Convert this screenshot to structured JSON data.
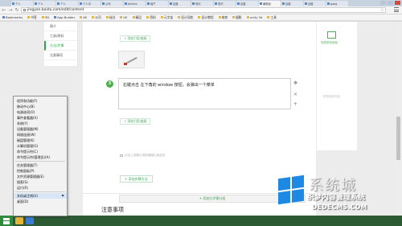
{
  "browser": {
    "tabs": [
      {
        "label": "个人"
      },
      {
        "label": "个人"
      },
      {
        "label": "个人"
      },
      {
        "label": "个人中"
      },
      {
        "label": "公司"
      },
      {
        "label": "Jenkins"
      },
      {
        "label": "用户"
      },
      {
        "label": "百度"
      },
      {
        "label": "常识"
      },
      {
        "label": "常识"
      },
      {
        "label": "百度"
      },
      {
        "label": "编辑经"
      },
      {
        "label": "百度"
      },
      {
        "label": "百度"
      },
      {
        "label": "goog"
      }
    ],
    "active_tab_index": 11,
    "url": "jingyan.baidu.com/edit/content",
    "bookmarks": [
      {
        "label": "Bookmarks"
      },
      {
        "label": "书签"
      },
      {
        "label": "3D"
      },
      {
        "label": "App Builder"
      },
      {
        "label": "AE"
      },
      {
        "label": "公司"
      },
      {
        "label": "硅谷"
      },
      {
        "label": "UE"
      },
      {
        "label": "精品"
      },
      {
        "label": "资料"
      },
      {
        "label": "元字宙"
      },
      {
        "label": "设计导航"
      },
      {
        "label": "设计教程"
      },
      {
        "label": "电商"
      },
      {
        "label": "摄影"
      },
      {
        "label": "unity 3d"
      },
      {
        "label": "工具"
      }
    ]
  },
  "leftnav": {
    "items": [
      {
        "label": "简介"
      },
      {
        "label": "工具/原料"
      },
      {
        "label": "方法/步骤"
      },
      {
        "label": "注意事项"
      }
    ]
  },
  "editor": {
    "add_link_label": "+ 添加引用/链接",
    "step_number": "3",
    "step_text": "右键点击 左下角的 window 按钮，会弹出一个菜单",
    "upload_hint": "点击上传图片或拖拽图片到此处",
    "add_step_label": "+ 添加步骤方法",
    "add_group_label": "+ 添加分步骤分组",
    "attention_title": "注意事项"
  },
  "right_panel": {
    "publish_label": "完成发布经验",
    "preview_label": "预览经验内容"
  },
  "context_menu": {
    "items": [
      {
        "label": "程序和功能(F)"
      },
      {
        "label": "移动中心(B)"
      },
      {
        "label": "电源选项(O)"
      },
      {
        "label": "事件查看器(V)"
      },
      {
        "label": "系统(Y)"
      },
      {
        "label": "设备管理器(M)"
      },
      {
        "label": "网络连接(W)"
      },
      {
        "label": "磁盘管理(K)"
      },
      {
        "label": "计算机管理(G)"
      },
      {
        "label": "命令提示符(C)"
      },
      {
        "label": "命令提示符(管理员)(A)"
      },
      {
        "label": "任务管理器(T)"
      },
      {
        "label": "控制面板(P)"
      },
      {
        "label": "文件资源管理器(E)"
      },
      {
        "label": "搜索(S)"
      },
      {
        "label": "运行(R)"
      },
      {
        "label": "关机或注销(U)"
      },
      {
        "label": "桌面(D)"
      }
    ],
    "submenu_arrow": "▶"
  },
  "watermark": {
    "big_text": "系统城",
    "sub_text": "织梦内容管理系统",
    "domain": "DEDECMS.COM"
  },
  "colors": {
    "accent_green": "#4cae4c",
    "taskbar": "#2c5a32"
  }
}
